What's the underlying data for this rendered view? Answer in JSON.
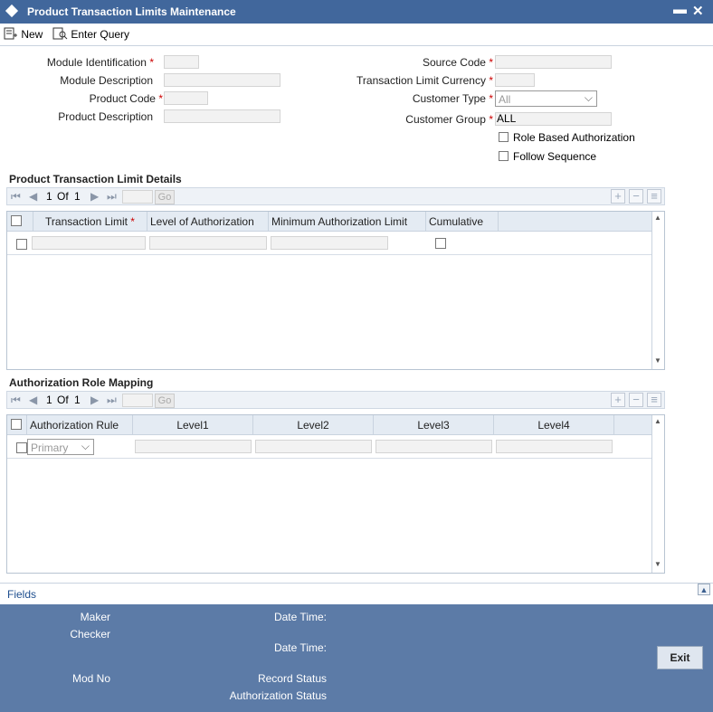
{
  "window": {
    "title": "Product Transaction Limits Maintenance",
    "minimize": "▬",
    "close": "✕"
  },
  "toolbar": {
    "new_label": "New",
    "enter_query_label": "Enter Query"
  },
  "form": {
    "module_identification": {
      "label": "Module Identification",
      "value": ""
    },
    "module_description": {
      "label": "Module Description",
      "value": ""
    },
    "product_code": {
      "label": "Product Code",
      "value": ""
    },
    "product_description": {
      "label": "Product Description",
      "value": ""
    },
    "source_code": {
      "label": "Source Code",
      "value": ""
    },
    "transaction_limit_currency": {
      "label": "Transaction Limit Currency",
      "value": ""
    },
    "customer_type": {
      "label": "Customer Type",
      "value": "All"
    },
    "customer_group": {
      "label": "Customer Group",
      "value": "ALL"
    },
    "role_based_authorization": {
      "label": "Role Based Authorization"
    },
    "follow_sequence": {
      "label": "Follow Sequence"
    },
    "required_mark": "*"
  },
  "limit_details": {
    "title": "Product Transaction Limit Details",
    "pager": {
      "first": "⏮",
      "prev": "◀",
      "current": "1",
      "of": "Of",
      "total": "1",
      "next": "▶",
      "last": "⏭",
      "go": "Go"
    },
    "columns": [
      "Transaction Limit",
      "Level of Authorization",
      "Minimum Authorization Limit",
      "Cumulative"
    ]
  },
  "role_mapping": {
    "title": "Authorization Role Mapping",
    "pager": {
      "first": "⏮",
      "prev": "◀",
      "current": "1",
      "of": "Of",
      "total": "1",
      "next": "▶",
      "last": "⏭",
      "go": "Go"
    },
    "columns": [
      "Authorization Rule",
      "Level1",
      "Level2",
      "Level3",
      "Level4"
    ],
    "rule_value": "Primary"
  },
  "fields_link": "Fields",
  "footer": {
    "maker": "Maker",
    "checker": "Checker",
    "date_time_1": "Date Time:",
    "date_time_2": "Date Time:",
    "mod_no": "Mod No",
    "record_status": "Record Status",
    "authorization_status": "Authorization Status",
    "exit": "Exit"
  }
}
